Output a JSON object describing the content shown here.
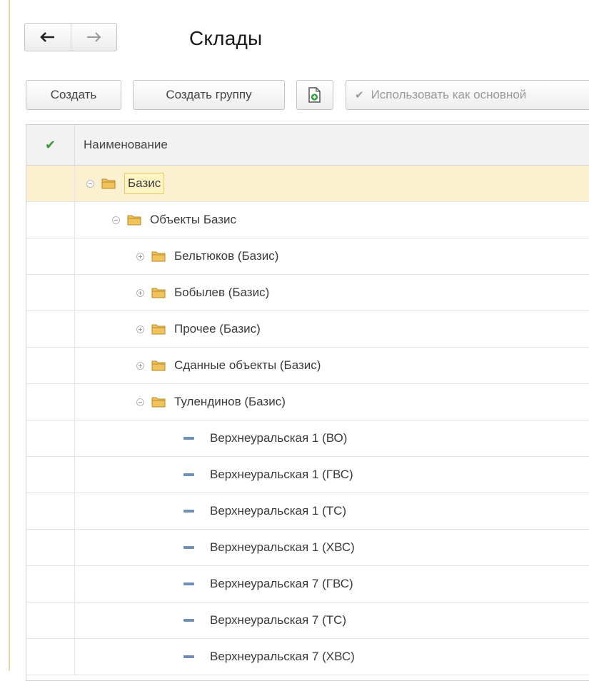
{
  "window": {
    "title": "Склады"
  },
  "nav": {
    "back_icon": "arrow-left-icon",
    "forward_icon": "arrow-right-icon"
  },
  "toolbar": {
    "create_label": "Создать",
    "create_group_label": "Создать группу",
    "copy_icon": "copy-document-icon",
    "use_main_label": "Использовать как основной"
  },
  "table": {
    "header": {
      "check_icon": "check-icon",
      "name_label": "Наименование"
    },
    "rows": [
      {
        "label": "Базис",
        "kind": "group",
        "expander": "minus",
        "selected": true
      },
      {
        "label": "Объекты Базис",
        "kind": "group",
        "expander": "minus",
        "selected": false
      },
      {
        "label": "Бельтюков (Базис)",
        "kind": "group",
        "expander": "plus",
        "selected": false
      },
      {
        "label": "Бобылев (Базис)",
        "kind": "group",
        "expander": "plus",
        "selected": false
      },
      {
        "label": "Прочее (Базис)",
        "kind": "group",
        "expander": "plus",
        "selected": false
      },
      {
        "label": "Сданные объекты (Базис)",
        "kind": "group",
        "expander": "plus",
        "selected": false
      },
      {
        "label": "Тулендинов (Базис)",
        "kind": "group",
        "expander": "minus",
        "selected": false
      },
      {
        "label": "Верхнеуральская 1 (ВО)",
        "kind": "item",
        "selected": false
      },
      {
        "label": "Верхнеуральская 1 (ГВС)",
        "kind": "item",
        "selected": false
      },
      {
        "label": "Верхнеуральская 1 (ТС)",
        "kind": "item",
        "selected": false
      },
      {
        "label": "Верхнеуральская 1 (ХВС)",
        "kind": "item",
        "selected": false
      },
      {
        "label": "Верхнеуральская 7 (ГВС)",
        "kind": "item",
        "selected": false
      },
      {
        "label": "Верхнеуральская 7 (ТС)",
        "kind": "item",
        "selected": false
      },
      {
        "label": "Верхнеуральская 7 (ХВС)",
        "kind": "item",
        "selected": false
      }
    ]
  },
  "colors": {
    "selected_row": "#fbf0cf",
    "folder_fill": "#f0c45a",
    "item_marker": "#6e8fb8",
    "check": "#3d9a3d"
  }
}
